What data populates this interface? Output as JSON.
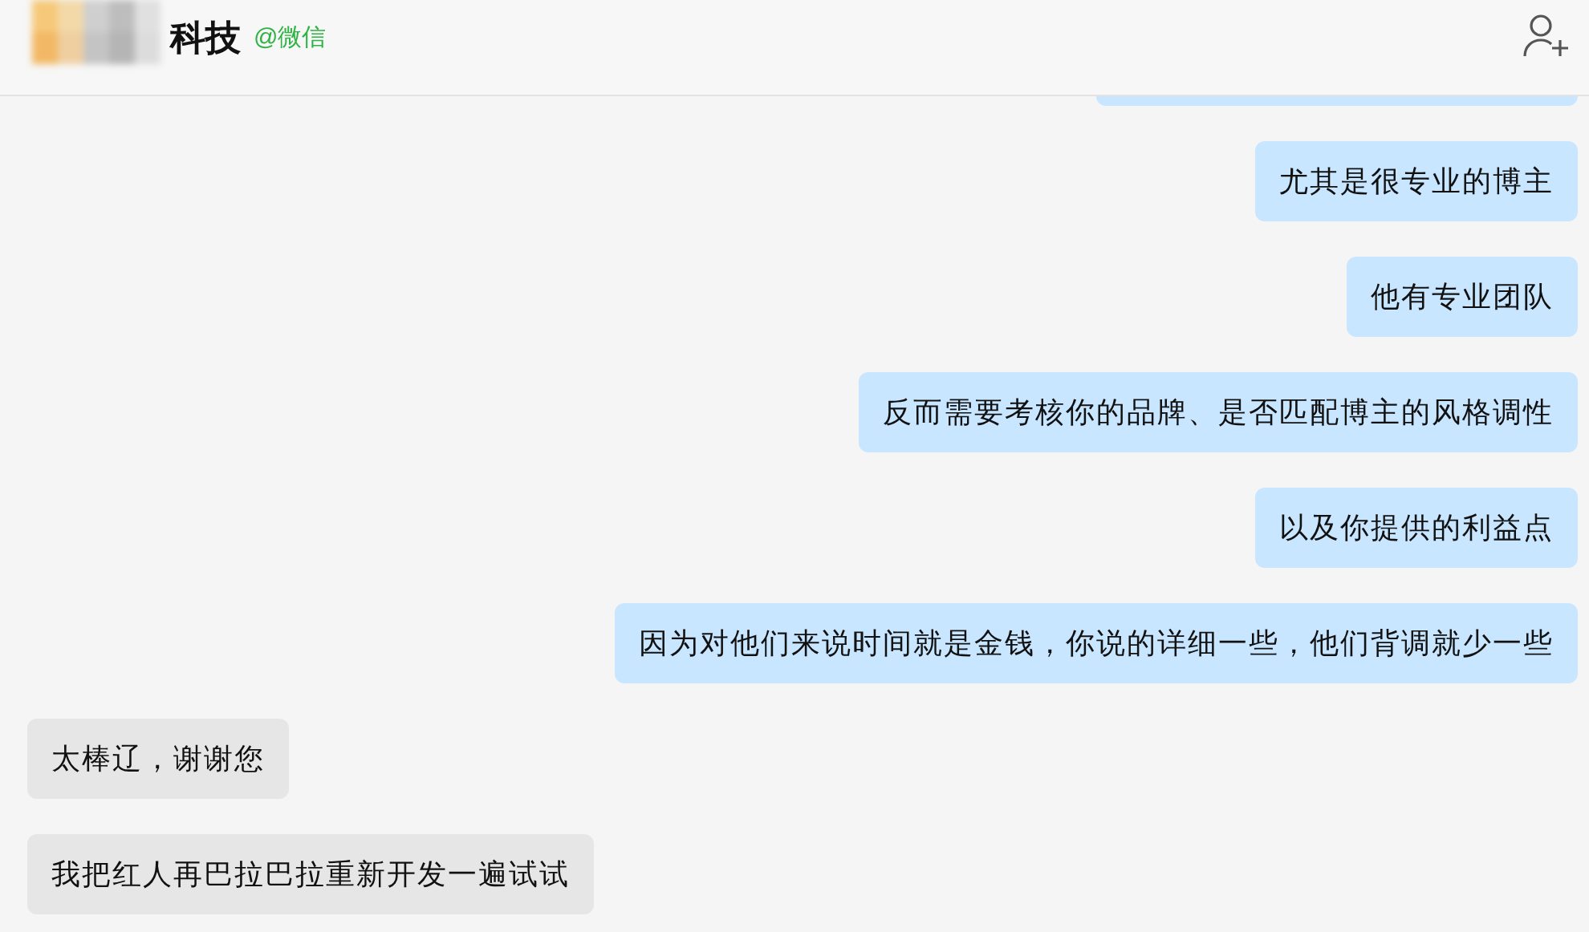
{
  "header": {
    "title": "科技",
    "source": "@微信"
  },
  "messages": [
    {
      "kind": "outgoing",
      "text": "尤其是很专业的博主"
    },
    {
      "kind": "outgoing",
      "text": "他有专业团队"
    },
    {
      "kind": "outgoing",
      "text": "反而需要考核你的品牌、是否匹配博主的风格调性"
    },
    {
      "kind": "outgoing",
      "text": "以及你提供的利益点"
    },
    {
      "kind": "outgoing",
      "text": "因为对他们来说时间就是金钱，你说的详细一些，他们背调就少一些"
    },
    {
      "kind": "incoming",
      "text": "太棒辽，谢谢您"
    },
    {
      "kind": "incoming",
      "text": "我把红人再巴拉巴拉重新开发一遍试试"
    }
  ]
}
